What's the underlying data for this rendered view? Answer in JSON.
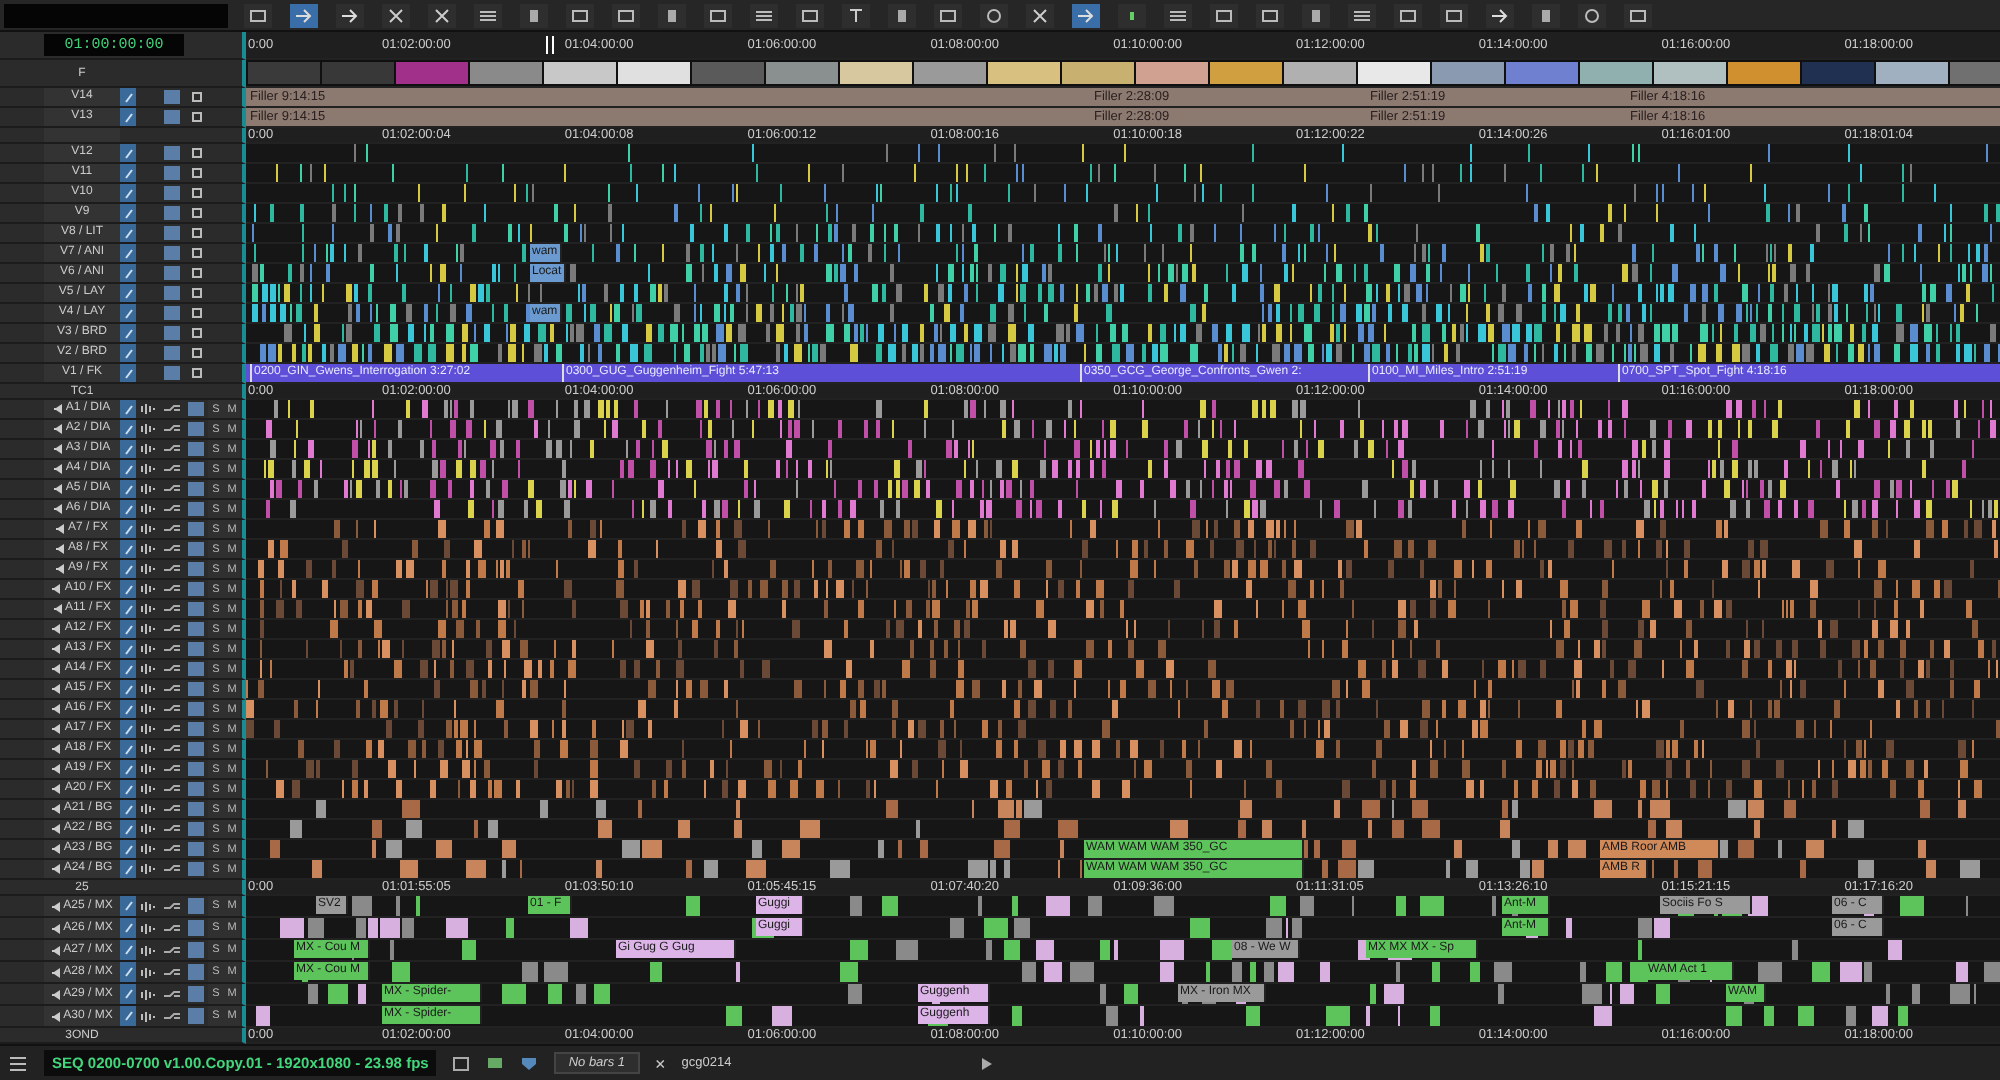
{
  "toolbar": [
    {
      "kind": "box",
      "selected": false
    },
    {
      "kind": "arrow",
      "selected": true
    },
    {
      "kind": "arrow",
      "selected": false
    },
    {
      "kind": "cut",
      "selected": false
    },
    {
      "kind": "cut",
      "selected": false
    },
    {
      "kind": "lines",
      "selected": false
    },
    {
      "kind": "bar",
      "selected": false
    },
    {
      "kind": "box",
      "selected": false
    },
    {
      "kind": "box",
      "selected": false
    },
    {
      "kind": "bar",
      "selected": false
    },
    {
      "kind": "box",
      "selected": false
    },
    {
      "kind": "lines",
      "selected": false
    },
    {
      "kind": "box",
      "selected": false
    },
    {
      "kind": "text",
      "selected": false
    },
    {
      "kind": "bar",
      "selected": false
    },
    {
      "kind": "box",
      "selected": false
    },
    {
      "kind": "circle",
      "selected": false
    },
    {
      "kind": "cut",
      "selected": false
    },
    {
      "kind": "arrow",
      "selected": true
    },
    {
      "kind": "dot",
      "selected": false
    },
    {
      "kind": "lines",
      "selected": false
    },
    {
      "kind": "box",
      "selected": false
    },
    {
      "kind": "box",
      "selected": false
    },
    {
      "kind": "bar",
      "selected": false
    },
    {
      "kind": "lines",
      "selected": false
    },
    {
      "kind": "box",
      "selected": false
    },
    {
      "kind": "box",
      "selected": false
    },
    {
      "kind": "arrow",
      "selected": false
    },
    {
      "kind": "bar",
      "selected": false
    },
    {
      "kind": "circle",
      "selected": false
    },
    {
      "kind": "box",
      "selected": false
    }
  ],
  "rows": [
    {
      "kind": "ruler",
      "header": "01:00:00:00",
      "labels": [
        "0:00",
        "01:02:00:00",
        "01:04:00:00",
        "01:06:00:00",
        "01:08:00:00",
        "01:10:00:00",
        "01:12:00:00",
        "01:14:00:00",
        "01:16:00:00",
        "01:18:00:00"
      ]
    },
    {
      "kind": "thumbnails",
      "header": "F"
    },
    {
      "kind": "filler",
      "name": "V14",
      "segments": [
        "Filler 9:14:15",
        "Filler 2:28:09",
        "Filler 2:51:19",
        "Filler 4:18:16"
      ]
    },
    {
      "kind": "filler",
      "name": "V13",
      "segments": [
        "Filler 9:14:15",
        "Filler 2:28:09",
        "Filler 2:51:19",
        "Filler 4:18:16"
      ]
    },
    {
      "kind": "ruler",
      "labels": [
        "0:00",
        "01:02:00:04",
        "01:04:00:08",
        "01:06:00:12",
        "01:08:00:16",
        "01:10:00:18",
        "01:12:00:22",
        "01:14:00:26",
        "01:16:01:00",
        "01:18:01:04"
      ]
    },
    {
      "kind": "video",
      "name": "V12"
    },
    {
      "kind": "video",
      "name": "V11"
    },
    {
      "kind": "video",
      "name": "V10"
    },
    {
      "kind": "video",
      "name": "V9"
    },
    {
      "kind": "video",
      "name": "V8 / LIT"
    },
    {
      "kind": "video",
      "name": "V7 / ANI",
      "clips": [
        {
          "label": "wam",
          "color": "#6a9ad0"
        }
      ]
    },
    {
      "kind": "video",
      "name": "V6 / ANI",
      "clips": [
        {
          "label": "Locat",
          "color": "#6a9ad0"
        }
      ]
    },
    {
      "kind": "video",
      "name": "V5 / LAY"
    },
    {
      "kind": "video",
      "name": "V4 / LAY",
      "clips": [
        {
          "label": "wam",
          "color": "#6a9ad0"
        }
      ]
    },
    {
      "kind": "video",
      "name": "V3 / BRD"
    },
    {
      "kind": "video",
      "name": "V2 / BRD"
    },
    {
      "kind": "sequence",
      "name": "V1 / FK",
      "clips": [
        {
          "label": "0200_GIN_Gwens_Interrogation 3:27:02"
        },
        {
          "label": "0300_GUG_Guggenheim_Fight 5:47:13"
        },
        {
          "label": "0350_GCG_George_Confronts_Gwen 2:"
        },
        {
          "label": "0100_MI_Miles_Intro 2:51:19"
        },
        {
          "label": "0700_SPT_Spot_Fight 4:18:16"
        }
      ]
    },
    {
      "kind": "ruler",
      "name": "TC1",
      "labels": [
        "0:00",
        "01:02:00:00",
        "01:04:00:00",
        "01:06:00:00",
        "01:08:00:00",
        "01:10:00:00",
        "01:12:00:00",
        "01:14:00:00",
        "01:16:00:00",
        "01:18:00:00"
      ]
    },
    {
      "kind": "dialogue",
      "name": "A1 / DIA",
      "solo": "S",
      "mute": "M"
    },
    {
      "kind": "dialogue",
      "name": "A2 / DIA",
      "solo": "S",
      "mute": "M"
    },
    {
      "kind": "dialogue",
      "name": "A3 / DIA",
      "solo": "S",
      "mute": "M"
    },
    {
      "kind": "dialogue",
      "name": "A4 / DIA",
      "solo": "S",
      "mute": "M"
    },
    {
      "kind": "dialogue",
      "name": "A5 / DIA",
      "solo": "S",
      "mute": "M"
    },
    {
      "kind": "dialogue",
      "name": "A6 / DIA",
      "solo": "S",
      "mute": "M"
    },
    {
      "kind": "fx",
      "name": "A7 / FX",
      "solo": "S",
      "mute": "M"
    },
    {
      "kind": "fx",
      "name": "A8 / FX",
      "solo": "S",
      "mute": "M"
    },
    {
      "kind": "fx",
      "name": "A9 / FX",
      "solo": "S",
      "mute": "M"
    },
    {
      "kind": "fx",
      "name": "A10 / FX",
      "solo": "S",
      "mute": "M"
    },
    {
      "kind": "fx",
      "name": "A11 / FX",
      "solo": "S",
      "mute": "M"
    },
    {
      "kind": "fx",
      "name": "A12 / FX",
      "solo": "S",
      "mute": "M"
    },
    {
      "kind": "fx",
      "name": "A13 / FX",
      "solo": "S",
      "mute": "M"
    },
    {
      "kind": "fx",
      "name": "A14 / FX",
      "solo": "S",
      "mute": "M"
    },
    {
      "kind": "fx",
      "name": "A15 / FX",
      "solo": "S",
      "mute": "M"
    },
    {
      "kind": "fx",
      "name": "A16 / FX",
      "solo": "S",
      "mute": "M"
    },
    {
      "kind": "fx",
      "name": "A17 / FX",
      "solo": "S",
      "mute": "M"
    },
    {
      "kind": "fx",
      "name": "A18 / FX",
      "solo": "S",
      "mute": "M"
    },
    {
      "kind": "fx",
      "name": "A19 / FX",
      "solo": "S",
      "mute": "M"
    },
    {
      "kind": "fx",
      "name": "A20 / FX",
      "solo": "S",
      "mute": "M"
    },
    {
      "kind": "bg",
      "name": "A21 / BG",
      "solo": "S",
      "mute": "M"
    },
    {
      "kind": "bg",
      "name": "A22 / BG",
      "solo": "S",
      "mute": "M"
    },
    {
      "kind": "bg",
      "name": "A23 / BG",
      "solo": "S",
      "mute": "M",
      "clips": [
        {
          "label": "WAM WAM WAM 350_GC",
          "color": "#5cc45a"
        },
        {
          "label": "AMB Roor AMB",
          "color": "#d08a5a"
        }
      ]
    },
    {
      "kind": "bg",
      "name": "A24 / BG",
      "solo": "S",
      "mute": "M",
      "clips": [
        {
          "label": "WAM WAM WAM 350_GC",
          "color": "#5cc45a"
        },
        {
          "label": "AMB R",
          "color": "#d08a5a"
        }
      ]
    },
    {
      "kind": "ruler",
      "name": "25",
      "labels": [
        "0:00",
        "01:01:55:05",
        "01:03:50:10",
        "01:05:45:15",
        "01:07:40:20",
        "01:09:36:00",
        "01:11:31:05",
        "01:13:26:10",
        "01:15:21:15",
        "01:17:16:20"
      ]
    },
    {
      "kind": "music",
      "name": "A25 / MX",
      "solo": "S",
      "mute": "M",
      "clips": [
        {
          "label": "SV2",
          "color": "#9a9a9a"
        },
        {
          "label": "01 - F",
          "color": "#5cc45a"
        },
        {
          "label": "Guggi",
          "color": "#dcb4e8"
        },
        {
          "label": "Ant-M",
          "color": "#5cc45a"
        },
        {
          "label": "Sociis Fo S",
          "color": "#9a9a9a"
        },
        {
          "label": "06 - C",
          "color": "#9a9a9a"
        }
      ]
    },
    {
      "kind": "music",
      "name": "A26 / MX",
      "solo": "S",
      "mute": "M",
      "clips": [
        {
          "label": "Guggi",
          "color": "#dcb4e8"
        },
        {
          "label": "Ant-M",
          "color": "#5cc45a"
        },
        {
          "label": "06 - C",
          "color": "#9a9a9a"
        }
      ]
    },
    {
      "kind": "music",
      "name": "A27 / MX",
      "solo": "S",
      "mute": "M",
      "clips": [
        {
          "label": "MX - Cou M",
          "color": "#5cc45a"
        },
        {
          "label": "Gi Gug G Gug",
          "color": "#dcb4e8"
        },
        {
          "label": "08 - We W",
          "color": "#9a9a9a"
        },
        {
          "label": "MX MX MX - Sp",
          "color": "#5cc45a"
        }
      ]
    },
    {
      "kind": "music",
      "name": "A28 / MX",
      "solo": "S",
      "mute": "M",
      "clips": [
        {
          "label": "MX - Cou M",
          "color": "#5cc45a"
        },
        {
          "label": "WAM Act 1",
          "color": "#5cc45a"
        }
      ]
    },
    {
      "kind": "music",
      "name": "A29 / MX",
      "solo": "S",
      "mute": "M",
      "clips": [
        {
          "label": "MX - Spider-",
          "color": "#5cc45a"
        },
        {
          "label": "Guggenh",
          "color": "#dcb4e8"
        },
        {
          "label": "MX - Iron MX",
          "color": "#9a9a9a"
        },
        {
          "label": "WAM",
          "color": "#5cc45a"
        }
      ]
    },
    {
      "kind": "music",
      "name": "A30 / MX",
      "solo": "S",
      "mute": "M",
      "clips": [
        {
          "label": "MX - Spider-",
          "color": "#5cc45a"
        },
        {
          "label": "Guggenh",
          "color": "#dcb4e8"
        }
      ]
    },
    {
      "kind": "ruler",
      "name": "3OND",
      "labels": [
        "0:00",
        "01:02:00:00",
        "01:04:00:00",
        "01:06:00:00",
        "01:08:00:00",
        "01:10:00:00",
        "01:12:00:00",
        "01:14:00:00",
        "01:16:00:00",
        "01:18:00:00"
      ]
    }
  ],
  "status_bar": {
    "sequence": "SEQ 0200-0700 v1.00.Copy.01 - 1920x1080 - 23.98 fps",
    "bars": "No bars 1",
    "close": "×",
    "clip_name": "gcg0214"
  }
}
